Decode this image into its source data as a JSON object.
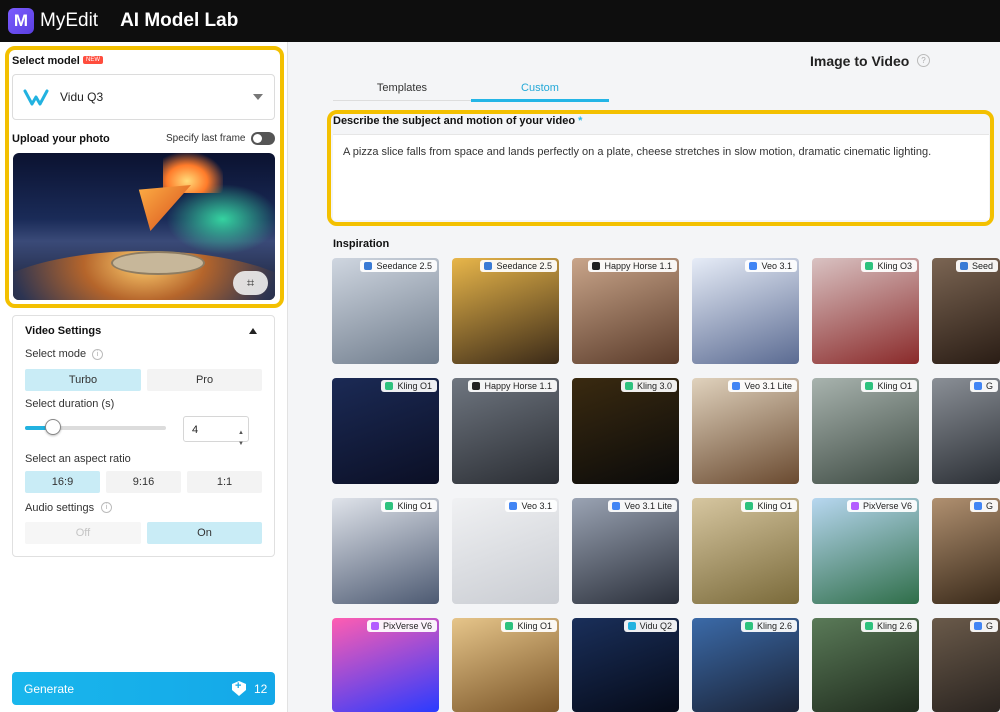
{
  "app": {
    "logo_letter": "M",
    "brand": "MyEdit",
    "title": "AI Model Lab"
  },
  "left": {
    "select_model_label": "Select model",
    "new_badge": "NEW",
    "model": "Vidu Q3",
    "upload_label": "Upload your photo",
    "specify_last_frame": "Specify last frame",
    "crop_icon_glyph": "⌗",
    "settings": {
      "title": "Video Settings",
      "mode_label": "Select mode",
      "modes": [
        "Turbo",
        "Pro"
      ],
      "active_mode": "Turbo",
      "duration_label": "Select duration (s)",
      "duration_value": "4",
      "duration_slider_fraction": 0.2,
      "aspect_label": "Select an aspect ratio",
      "aspects": [
        "16:9",
        "9:16",
        "1:1"
      ],
      "active_aspect": "16:9",
      "audio_label": "Audio settings",
      "audio_options": [
        "Off",
        "On"
      ],
      "active_audio": "On"
    },
    "generate_label": "Generate",
    "generate_credits": "12"
  },
  "main": {
    "title": "Image to Video",
    "tabs": [
      "Templates",
      "Custom"
    ],
    "active_tab": "Custom",
    "prompt_label": "Describe the subject and motion of your video",
    "prompt_required": "*",
    "prompt_text": "A pizza slice falls from space and lands perfectly on a plate, cheese stretches in slow motion, dramatic cinematic lighting.",
    "inspiration_label": "Inspiration",
    "tiles": [
      {
        "badge": "Seedance 2.5",
        "icon": "seedance-icon",
        "icon_color": "#3a7bd5",
        "colors": [
          "#cfd6e0",
          "#6f7c8c"
        ]
      },
      {
        "badge": "Seedance 2.5",
        "icon": "seedance-icon",
        "icon_color": "#3a7bd5",
        "colors": [
          "#e8b64a",
          "#3b2a18"
        ]
      },
      {
        "badge": "Happy Horse 1.1",
        "icon": "horse-icon",
        "icon_color": "#222222",
        "colors": [
          "#c9a58a",
          "#5a3b2a"
        ]
      },
      {
        "badge": "Veo 3.1",
        "icon": "google-icon",
        "icon_color": "#4285f4",
        "colors": [
          "#e6ecf7",
          "#5b6b92"
        ]
      },
      {
        "badge": "Kling O3",
        "icon": "kling-icon",
        "icon_color": "#2ec27e",
        "colors": [
          "#d9c2c2",
          "#8a2a2a"
        ]
      },
      {
        "badge": "Seed",
        "icon": "seedance-icon",
        "icon_color": "#3a7bd5",
        "colors": [
          "#7b6553",
          "#2a1d15"
        ]
      },
      {
        "badge": "Kling O1",
        "icon": "kling-icon",
        "icon_color": "#2ec27e",
        "colors": [
          "#1b2a55",
          "#0b0f25"
        ]
      },
      {
        "badge": "Happy Horse 1.1",
        "icon": "horse-icon",
        "icon_color": "#222222",
        "colors": [
          "#6f7680",
          "#2a2d33"
        ]
      },
      {
        "badge": "Kling 3.0",
        "icon": "kling-icon",
        "icon_color": "#2ec27e",
        "colors": [
          "#3a2a10",
          "#0a0a0a"
        ]
      },
      {
        "badge": "Veo 3.1 Lite",
        "icon": "google-icon",
        "icon_color": "#4285f4",
        "colors": [
          "#e0d2bd",
          "#6a4a30"
        ]
      },
      {
        "badge": "Kling O1",
        "icon": "kling-icon",
        "icon_color": "#2ec27e",
        "colors": [
          "#a8b3ae",
          "#3d4a42"
        ]
      },
      {
        "badge": "G",
        "icon": "google-icon",
        "icon_color": "#4285f4",
        "colors": [
          "#8a8f96",
          "#2c3036"
        ]
      },
      {
        "badge": "Kling O1",
        "icon": "kling-icon",
        "icon_color": "#2ec27e",
        "colors": [
          "#dfe3ea",
          "#4d5a72"
        ]
      },
      {
        "badge": "Veo 3.1",
        "icon": "google-icon",
        "icon_color": "#4285f4",
        "colors": [
          "#f0f1f3",
          "#c9ccd2"
        ]
      },
      {
        "badge": "Veo 3.1 Lite",
        "icon": "google-icon",
        "icon_color": "#4285f4",
        "colors": [
          "#9aa3b3",
          "#2a2f3a"
        ]
      },
      {
        "badge": "Kling O1",
        "icon": "kling-icon",
        "icon_color": "#2ec27e",
        "colors": [
          "#d6c6a0",
          "#7a6a3a"
        ]
      },
      {
        "badge": "PixVerse V6",
        "icon": "pixverse-icon",
        "icon_color": "#b35cff",
        "colors": [
          "#b7d7f0",
          "#2f6e49"
        ]
      },
      {
        "badge": "G",
        "icon": "google-icon",
        "icon_color": "#4285f4",
        "colors": [
          "#b09070",
          "#3a2a1a"
        ]
      },
      {
        "badge": "PixVerse V6",
        "icon": "pixverse-icon",
        "icon_color": "#b35cff",
        "colors": [
          "#ff5db1",
          "#2a3bff"
        ]
      },
      {
        "badge": "Kling O1",
        "icon": "kling-icon",
        "icon_color": "#2ec27e",
        "colors": [
          "#e6c58a",
          "#7a5528"
        ]
      },
      {
        "badge": "Vidu Q2",
        "icon": "vidu-icon",
        "icon_color": "#22b2e0",
        "colors": [
          "#1a2f5a",
          "#050a18"
        ]
      },
      {
        "badge": "Kling 2.6",
        "icon": "kling-icon",
        "icon_color": "#2ec27e",
        "colors": [
          "#3b6aa8",
          "#1a2235"
        ]
      },
      {
        "badge": "Kling 2.6",
        "icon": "kling-icon",
        "icon_color": "#2ec27e",
        "colors": [
          "#5a7a58",
          "#1f2b1d"
        ]
      },
      {
        "badge": "G",
        "icon": "google-icon",
        "icon_color": "#4285f4",
        "colors": [
          "#6a5a4a",
          "#2a2420"
        ]
      }
    ]
  }
}
